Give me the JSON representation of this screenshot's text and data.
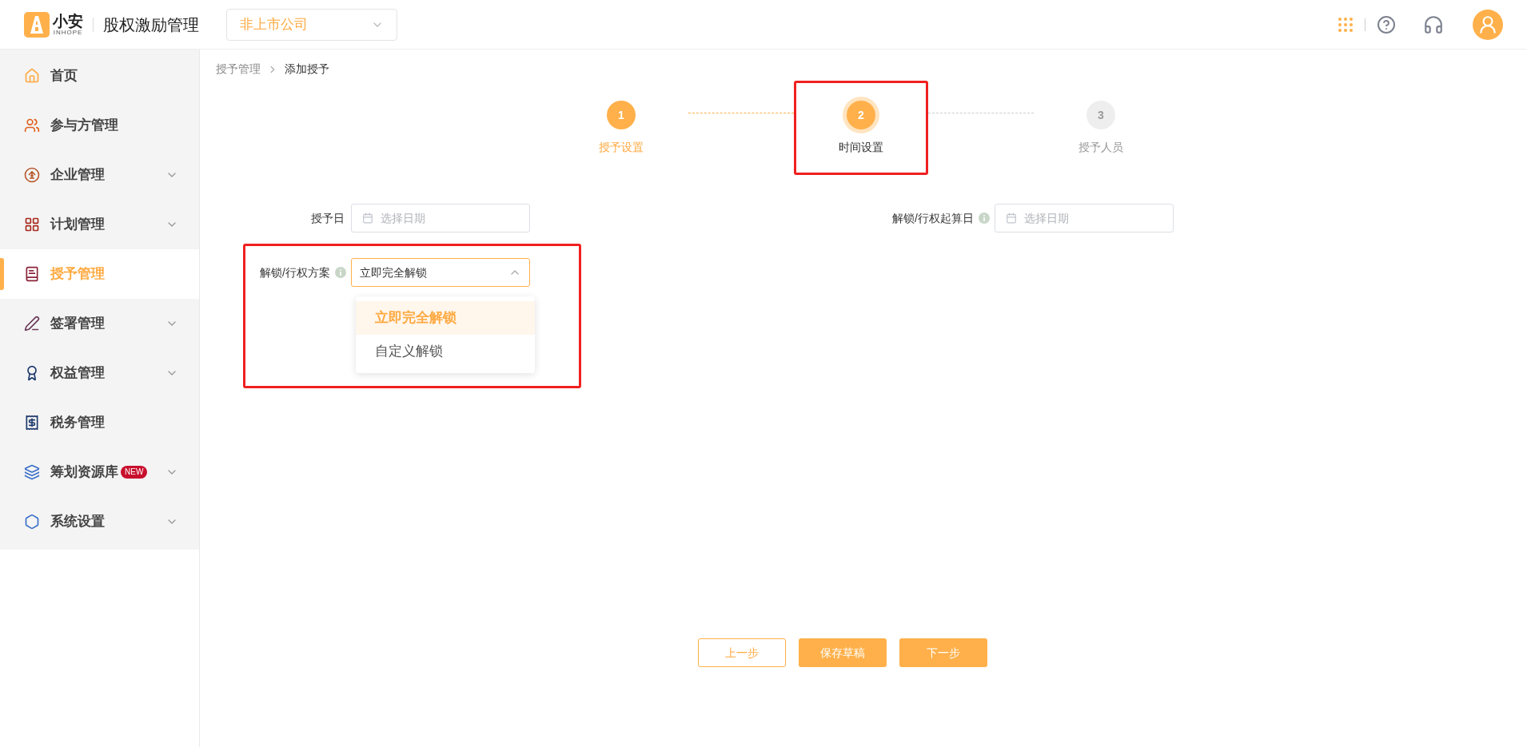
{
  "header": {
    "logo": {
      "name": "小安",
      "sub": "INHOPE"
    },
    "app_title": "股权激励管理",
    "company_select": {
      "value": "非上市公司"
    }
  },
  "sidebar": {
    "items": [
      {
        "kind": "home",
        "label": "首页",
        "expandable": false,
        "selected": false
      },
      {
        "kind": "people",
        "label": "参与方管理",
        "expandable": false,
        "selected": false
      },
      {
        "kind": "enterprise",
        "label": "企业管理",
        "expandable": true,
        "selected": false
      },
      {
        "kind": "grid",
        "label": "计划管理",
        "expandable": true,
        "selected": false
      },
      {
        "kind": "book",
        "label": "授予管理",
        "expandable": false,
        "selected": true
      },
      {
        "kind": "pen",
        "label": "签署管理",
        "expandable": true,
        "selected": false
      },
      {
        "kind": "medal",
        "label": "权益管理",
        "expandable": true,
        "selected": false
      },
      {
        "kind": "tax",
        "label": "税务管理",
        "expandable": false,
        "selected": false
      },
      {
        "kind": "layers",
        "label": "筹划资源库",
        "badge": "NEW",
        "expandable": true,
        "selected": false
      },
      {
        "kind": "hexagon",
        "label": "系统设置",
        "expandable": true,
        "selected": false
      }
    ]
  },
  "breadcrumb": [
    "授予管理",
    "添加授予"
  ],
  "steps": [
    {
      "number": "1",
      "label": "授予设置",
      "completed": true,
      "selected": false,
      "highlighted": false
    },
    {
      "number": "2",
      "label": "时间设置",
      "completed": false,
      "selected": true,
      "highlighted": true
    },
    {
      "number": "3",
      "label": "授予人员",
      "completed": false,
      "selected": false,
      "highlighted": false
    }
  ],
  "form": {
    "grant_date": {
      "label": "授予日",
      "placeholder": "选择日期"
    },
    "unlock_start_date": {
      "label": "解锁/行权起算日",
      "info": true,
      "placeholder": "选择日期"
    },
    "unlock_plan": {
      "label": "解锁/行权方案",
      "info": true,
      "value": "立即完全解锁",
      "expanded": true,
      "highlighted": true,
      "options": [
        {
          "label": "立即完全解锁",
          "selected": true
        },
        {
          "label": "自定义解锁",
          "selected": false
        }
      ]
    }
  },
  "buttons": [
    {
      "kind": "outline",
      "label": "上一步"
    },
    {
      "kind": "solid",
      "label": "保存草稿"
    },
    {
      "kind": "solid",
      "label": "下一步"
    }
  ]
}
